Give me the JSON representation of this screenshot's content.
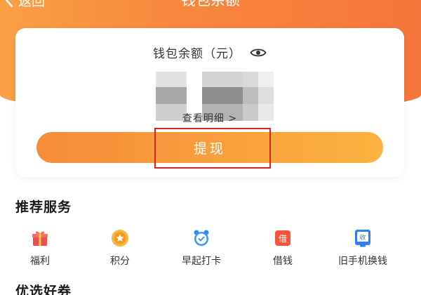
{
  "nav": {
    "back_label": "返回",
    "title": "钱包余额"
  },
  "wallet": {
    "balance_label": "钱包余额（元）",
    "detail_link": "查看明细 >",
    "withdraw_button": "提现"
  },
  "recommended": {
    "title": "推荐服务",
    "items": [
      {
        "label": "福利",
        "icon": "gift-icon"
      },
      {
        "label": "积分",
        "icon": "coin-icon"
      },
      {
        "label": "早起打卡",
        "icon": "alarm-clock-icon"
      },
      {
        "label": "借钱",
        "icon": "loan-icon"
      },
      {
        "label": "旧手机换钱",
        "icon": "phone-trade-icon"
      }
    ]
  },
  "coupons": {
    "title": "优选好券"
  },
  "colors": {
    "brand_orange": "#f8883f",
    "highlight_red": "#e0201e"
  }
}
